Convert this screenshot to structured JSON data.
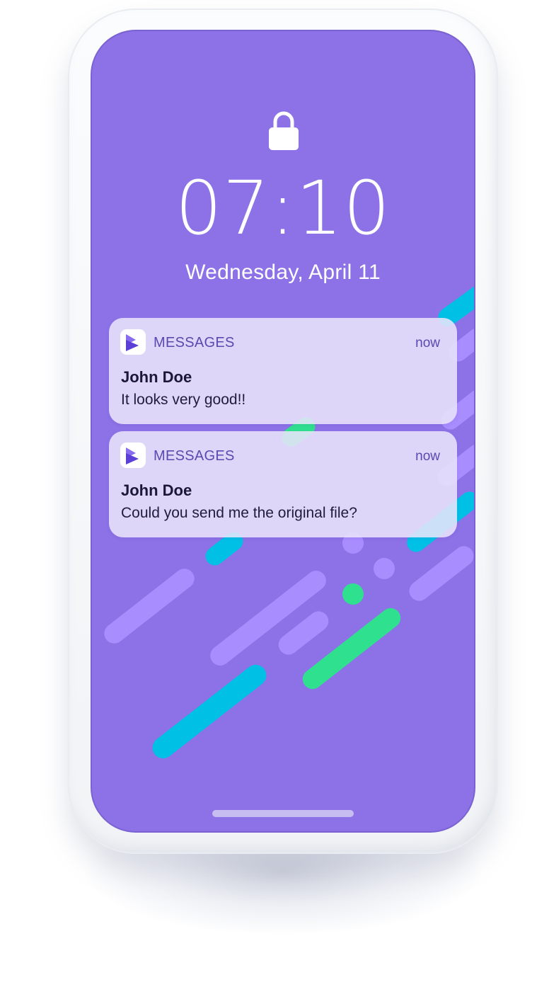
{
  "lock_screen": {
    "time": "07:10",
    "date": "Wednesday, April 11"
  },
  "notifications": [
    {
      "app_name": "MESSAGES",
      "time": "now",
      "sender": "John Doe",
      "message": "It looks very good!!"
    },
    {
      "app_name": "MESSAGES",
      "time": "now",
      "sender": "John Doe",
      "message": "Could you send me the original file?"
    }
  ],
  "colors": {
    "wallpaper": "#8c72e6",
    "accent_cyan": "#00c0e6",
    "accent_green": "#2fe08f",
    "accent_violet": "#a88dff"
  },
  "icons": {
    "lock": "lock-icon",
    "app": "messages-app-icon"
  }
}
